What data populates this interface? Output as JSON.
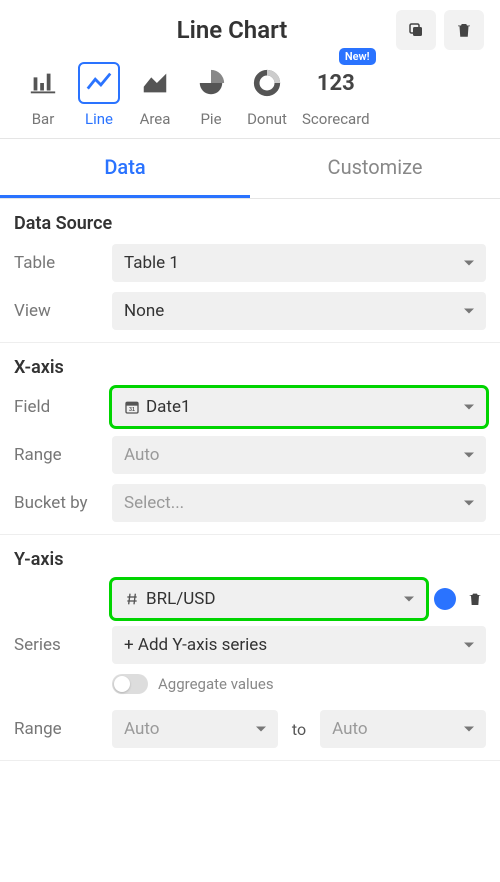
{
  "header": {
    "title": "Line Chart",
    "copy_aria": "Duplicate",
    "delete_aria": "Delete"
  },
  "chart_types": {
    "bar": "Bar",
    "line": "Line",
    "area": "Area",
    "pie": "Pie",
    "donut": "Donut",
    "scorecard": "Scorecard",
    "scorecard_value": "123",
    "new_badge": "New!"
  },
  "tabs": {
    "data": "Data",
    "customize": "Customize"
  },
  "data_source": {
    "title": "Data Source",
    "table_label": "Table",
    "table_value": "Table 1",
    "view_label": "View",
    "view_value": "None"
  },
  "x_axis": {
    "title": "X-axis",
    "field_label": "Field",
    "field_value": "Date1",
    "range_label": "Range",
    "range_value": "Auto",
    "bucket_label": "Bucket by",
    "bucket_placeholder": "Select..."
  },
  "y_axis": {
    "title": "Y-axis",
    "series_label": "Series",
    "series_value": "BRL/USD",
    "series_color": "#2a73ff",
    "add_series": "+ Add Y-axis series",
    "aggregate_label": "Aggregate values",
    "range_label": "Range",
    "range_from": "Auto",
    "range_to_label": "to",
    "range_to": "Auto"
  }
}
